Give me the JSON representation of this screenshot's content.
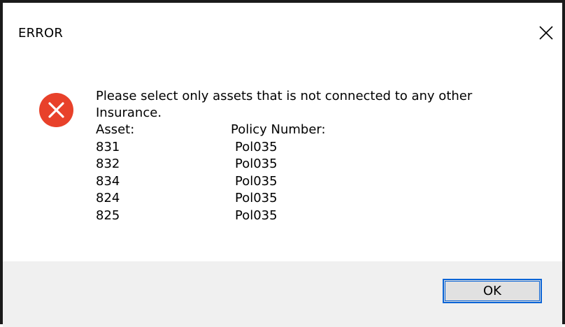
{
  "dialog": {
    "title": "ERROR",
    "close_icon": "close-icon",
    "icon": "error-icon",
    "icon_color": "#e8412a",
    "message_lines": [
      "Please select only assets that is not connected to any other",
      "Insurance."
    ],
    "headers": {
      "asset": "Asset:",
      "policy": "Policy Number:"
    },
    "rows": [
      {
        "asset": "831",
        "policy": "Pol035"
      },
      {
        "asset": "832",
        "policy": "Pol035"
      },
      {
        "asset": "834",
        "policy": "Pol035"
      },
      {
        "asset": "824",
        "policy": "Pol035"
      },
      {
        "asset": "825",
        "policy": "Pol035"
      }
    ],
    "ok_label": "OK",
    "accent_color": "#0a64d6"
  }
}
